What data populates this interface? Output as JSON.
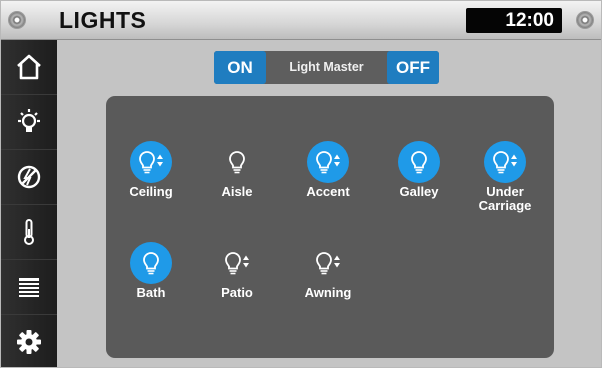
{
  "header": {
    "title": "LIGHTS",
    "clock": "12:00"
  },
  "sidebar": {
    "items": [
      {
        "name": "home-icon"
      },
      {
        "name": "light-bulb-icon"
      },
      {
        "name": "no-power-icon"
      },
      {
        "name": "thermometer-icon"
      },
      {
        "name": "awning-icon"
      },
      {
        "name": "gear-icon"
      }
    ]
  },
  "master": {
    "on_label": "ON",
    "label": "Light Master",
    "off_label": "OFF"
  },
  "lights": [
    {
      "label": "Ceiling",
      "active": true,
      "dimmable": true
    },
    {
      "label": "Aisle",
      "active": false,
      "dimmable": false
    },
    {
      "label": "Accent",
      "active": true,
      "dimmable": true
    },
    {
      "label": "Galley",
      "active": true,
      "dimmable": false
    },
    {
      "label": "Under\nCarriage",
      "active": true,
      "dimmable": true
    },
    {
      "label": "Bath",
      "active": true,
      "dimmable": false
    },
    {
      "label": "Patio",
      "active": false,
      "dimmable": true
    },
    {
      "label": "Awning",
      "active": false,
      "dimmable": true
    }
  ],
  "colors": {
    "accent": "#1f7dc0",
    "active_icon": "#1f9ae8",
    "panel": "#5a5a5a"
  }
}
